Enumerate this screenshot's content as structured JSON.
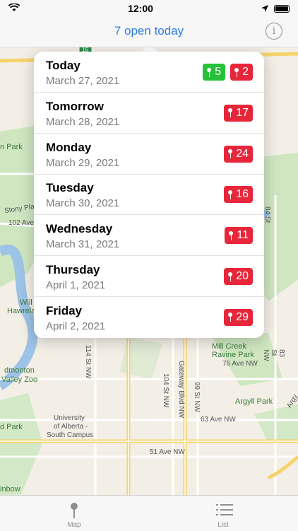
{
  "status": {
    "time": "12:00"
  },
  "navbar": {
    "title": "7 open today",
    "info_icon": "info-circle-icon",
    "info_glyph": "i"
  },
  "map": {
    "labels": {
      "stony_plain": "Stony Plai",
      "ave102": "102 Ave NW",
      "st84": "84 St NW",
      "park": "n Park",
      "will": "Will",
      "hawrelak": "Hawrela",
      "edmonton": "dmonton",
      "valley_zoo": "Valley Zoo",
      "st114": "114 St NW",
      "st104": "104 St NW",
      "gateway": "Gateway Blvd NW",
      "st99": "99 St NW",
      "mill_creek": "Mill Creek",
      "ravine_park": "Ravine Park",
      "st83": "83 St NW",
      "ave76": "76 Ave NW",
      "argyll_park": "Argyll Park",
      "argy": "Argy",
      "uofa1": "University",
      "uofa2": "of Alberta -",
      "uofa3": "South Campus",
      "d_park": "d Park",
      "ave63": "63 Ave NW",
      "ave51": "51 Ave NW",
      "rainbow": "inbow",
      "hwy16": "16"
    }
  },
  "schedule": [
    {
      "day": "Today",
      "date": "March 27, 2021",
      "badges": [
        {
          "color": "green",
          "count": "5"
        },
        {
          "color": "red",
          "count": "2"
        }
      ]
    },
    {
      "day": "Tomorrow",
      "date": "March 28, 2021",
      "badges": [
        {
          "color": "red",
          "count": "17"
        }
      ]
    },
    {
      "day": "Monday",
      "date": "March 29, 2021",
      "badges": [
        {
          "color": "red",
          "count": "24"
        }
      ]
    },
    {
      "day": "Tuesday",
      "date": "March 30, 2021",
      "badges": [
        {
          "color": "red",
          "count": "16"
        }
      ]
    },
    {
      "day": "Wednesday",
      "date": "March 31, 2021",
      "badges": [
        {
          "color": "red",
          "count": "11"
        }
      ]
    },
    {
      "day": "Thursday",
      "date": "April 1, 2021",
      "badges": [
        {
          "color": "red",
          "count": "20"
        }
      ]
    },
    {
      "day": "Friday",
      "date": "April 2, 2021",
      "badges": [
        {
          "color": "red",
          "count": "29"
        }
      ]
    }
  ],
  "colors": {
    "accent": "#2f7ce0",
    "open": "#27c137",
    "closed": "#e7263a"
  },
  "tabbar": {
    "map_label": "Map",
    "list_label": "List",
    "map_icon": "pin-icon",
    "list_icon": "list-icon"
  }
}
